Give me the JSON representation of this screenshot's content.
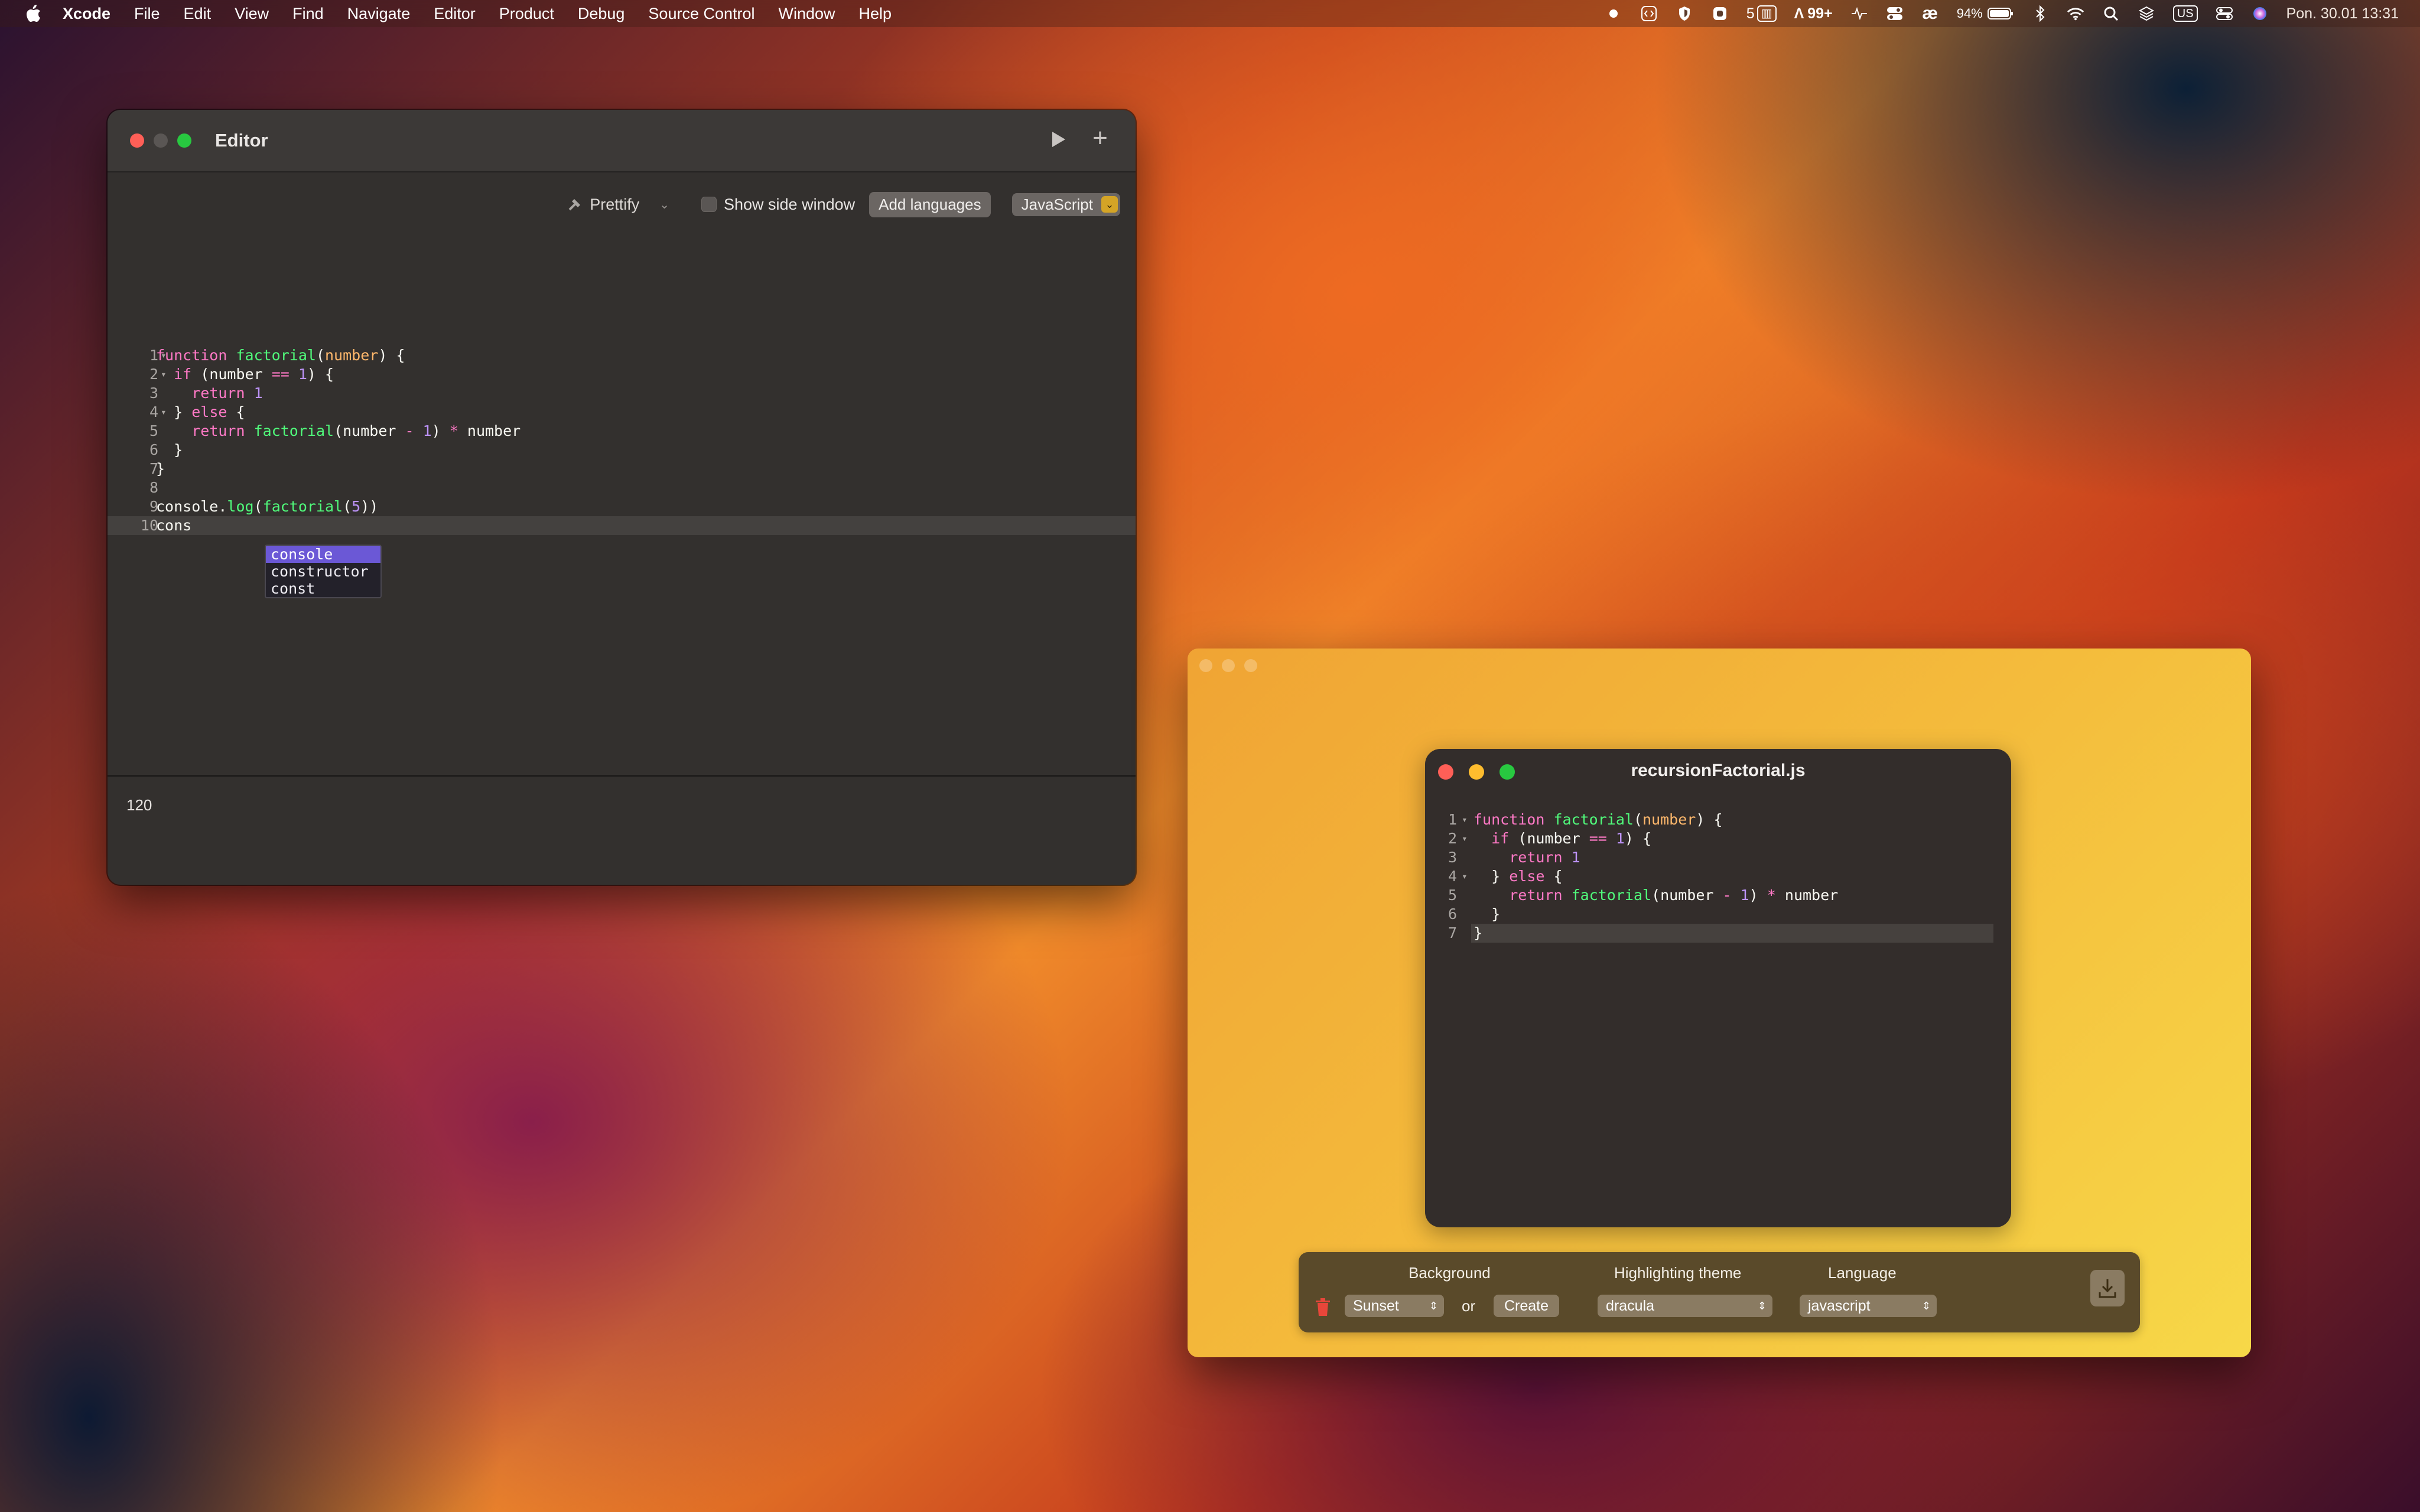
{
  "menubar": {
    "app_name": "Xcode",
    "items": [
      "File",
      "Edit",
      "View",
      "Find",
      "Navigate",
      "Editor",
      "Product",
      "Debug",
      "Source Control",
      "Window",
      "Help"
    ],
    "status_counter": "5",
    "notifications": "99+",
    "battery": "94%",
    "input_source": "US",
    "datetime": "Pon. 30.01  13:31"
  },
  "editor": {
    "title": "Editor",
    "toolbar": {
      "prettify": "Prettify",
      "show_side_window": "Show side window",
      "add_languages": "Add languages",
      "language": "JavaScript"
    },
    "lines": [
      {
        "n": "1",
        "fold": "▾",
        "tokens": [
          [
            "k",
            "function "
          ],
          [
            "f",
            "factorial"
          ],
          [
            "plain",
            "("
          ],
          [
            "p",
            "number"
          ],
          [
            "plain",
            ") {"
          ]
        ]
      },
      {
        "n": "2",
        "fold": "▾",
        "tokens": [
          [
            "plain",
            "  "
          ],
          [
            "k",
            "if"
          ],
          [
            "plain",
            " (number "
          ],
          [
            "k",
            "=="
          ],
          [
            "plain",
            " "
          ],
          [
            "n",
            "1"
          ],
          [
            "plain",
            ") {"
          ]
        ]
      },
      {
        "n": "3",
        "fold": "",
        "tokens": [
          [
            "plain",
            "    "
          ],
          [
            "k",
            "return"
          ],
          [
            "plain",
            " "
          ],
          [
            "n",
            "1"
          ]
        ]
      },
      {
        "n": "4",
        "fold": "▾",
        "tokens": [
          [
            "plain",
            "  } "
          ],
          [
            "k",
            "else"
          ],
          [
            "plain",
            " {"
          ]
        ]
      },
      {
        "n": "5",
        "fold": "",
        "tokens": [
          [
            "plain",
            "    "
          ],
          [
            "k",
            "return"
          ],
          [
            "plain",
            " "
          ],
          [
            "f",
            "factorial"
          ],
          [
            "plain",
            "(number "
          ],
          [
            "k",
            "-"
          ],
          [
            "plain",
            " "
          ],
          [
            "n",
            "1"
          ],
          [
            "plain",
            ") "
          ],
          [
            "k",
            "*"
          ],
          [
            "plain",
            " number"
          ]
        ]
      },
      {
        "n": "6",
        "fold": "",
        "tokens": [
          [
            "plain",
            "  }"
          ]
        ]
      },
      {
        "n": "7",
        "fold": "",
        "tokens": [
          [
            "plain",
            "}"
          ]
        ]
      },
      {
        "n": "8",
        "fold": "",
        "tokens": []
      },
      {
        "n": "9",
        "fold": "",
        "tokens": [
          [
            "plain",
            "console."
          ],
          [
            "f",
            "log"
          ],
          [
            "plain",
            "("
          ],
          [
            "f",
            "factorial"
          ],
          [
            "plain",
            "("
          ],
          [
            "n",
            "5"
          ],
          [
            "plain",
            "))"
          ]
        ]
      },
      {
        "n": "10",
        "fold": "",
        "tokens": [
          [
            "plain",
            "cons"
          ]
        ]
      }
    ],
    "autocomplete": [
      "console",
      "constructor",
      "const"
    ],
    "output": "120"
  },
  "capture": {
    "card_title": "recursionFactorial.js",
    "lines": [
      {
        "n": "1",
        "fold": "▾",
        "tokens": [
          [
            "k",
            "function "
          ],
          [
            "f",
            "factorial"
          ],
          [
            "plain",
            "("
          ],
          [
            "p",
            "number"
          ],
          [
            "plain",
            ") {"
          ]
        ]
      },
      {
        "n": "2",
        "fold": "▾",
        "tokens": [
          [
            "plain",
            "  "
          ],
          [
            "k",
            "if"
          ],
          [
            "plain",
            " (number "
          ],
          [
            "k",
            "=="
          ],
          [
            "plain",
            " "
          ],
          [
            "n",
            "1"
          ],
          [
            "plain",
            ") {"
          ]
        ]
      },
      {
        "n": "3",
        "fold": "",
        "tokens": [
          [
            "plain",
            "    "
          ],
          [
            "k",
            "return"
          ],
          [
            "plain",
            " "
          ],
          [
            "n",
            "1"
          ]
        ]
      },
      {
        "n": "4",
        "fold": "▾",
        "tokens": [
          [
            "plain",
            "  } "
          ],
          [
            "k",
            "else"
          ],
          [
            "plain",
            " {"
          ]
        ]
      },
      {
        "n": "5",
        "fold": "",
        "tokens": [
          [
            "plain",
            "    "
          ],
          [
            "k",
            "return"
          ],
          [
            "plain",
            " "
          ],
          [
            "f",
            "factorial"
          ],
          [
            "plain",
            "(number "
          ],
          [
            "k",
            "-"
          ],
          [
            "plain",
            " "
          ],
          [
            "n",
            "1"
          ],
          [
            "plain",
            ") "
          ],
          [
            "k",
            "*"
          ],
          [
            "plain",
            " number"
          ]
        ]
      },
      {
        "n": "6",
        "fold": "",
        "tokens": [
          [
            "plain",
            "  }"
          ]
        ]
      },
      {
        "n": "7",
        "fold": "",
        "tokens": [
          [
            "plain",
            "}"
          ]
        ]
      }
    ],
    "controls": {
      "background_label": "Background",
      "background_value": "Sunset",
      "or": "or",
      "create": "Create",
      "theme_label": "Highlighting theme",
      "theme_value": "dracula",
      "language_label": "Language",
      "language_value": "javascript"
    }
  },
  "colors": {
    "keyword": "#ff79c6",
    "function": "#50fa7b",
    "param": "#ffb86c",
    "number": "#bd93f9",
    "autocomplete_selected": "#6b58d6",
    "language_accent": "#d4a426"
  }
}
